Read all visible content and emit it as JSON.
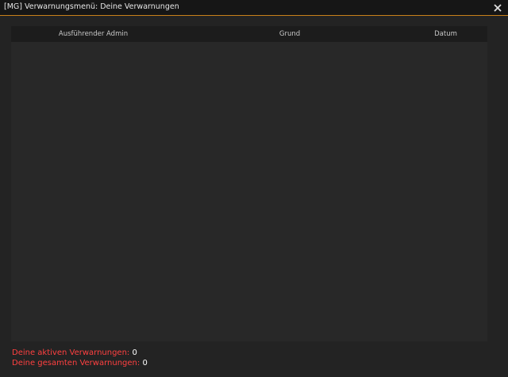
{
  "window": {
    "title": "[MG] Verwarnungsmenü: Deine Verwarnungen",
    "accent_color": "#c8801a",
    "close_icon": "close-icon"
  },
  "table": {
    "columns": [
      {
        "label": "Ausführender Admin"
      },
      {
        "label": "Grund"
      },
      {
        "label": "Datum"
      }
    ],
    "rows": []
  },
  "stats": {
    "active_label": "Deine aktiven Verwarnungen:",
    "active_value": "0",
    "total_label": "Deine gesamten Verwarnungen:",
    "total_value": "0",
    "label_color": "#ff4040"
  }
}
